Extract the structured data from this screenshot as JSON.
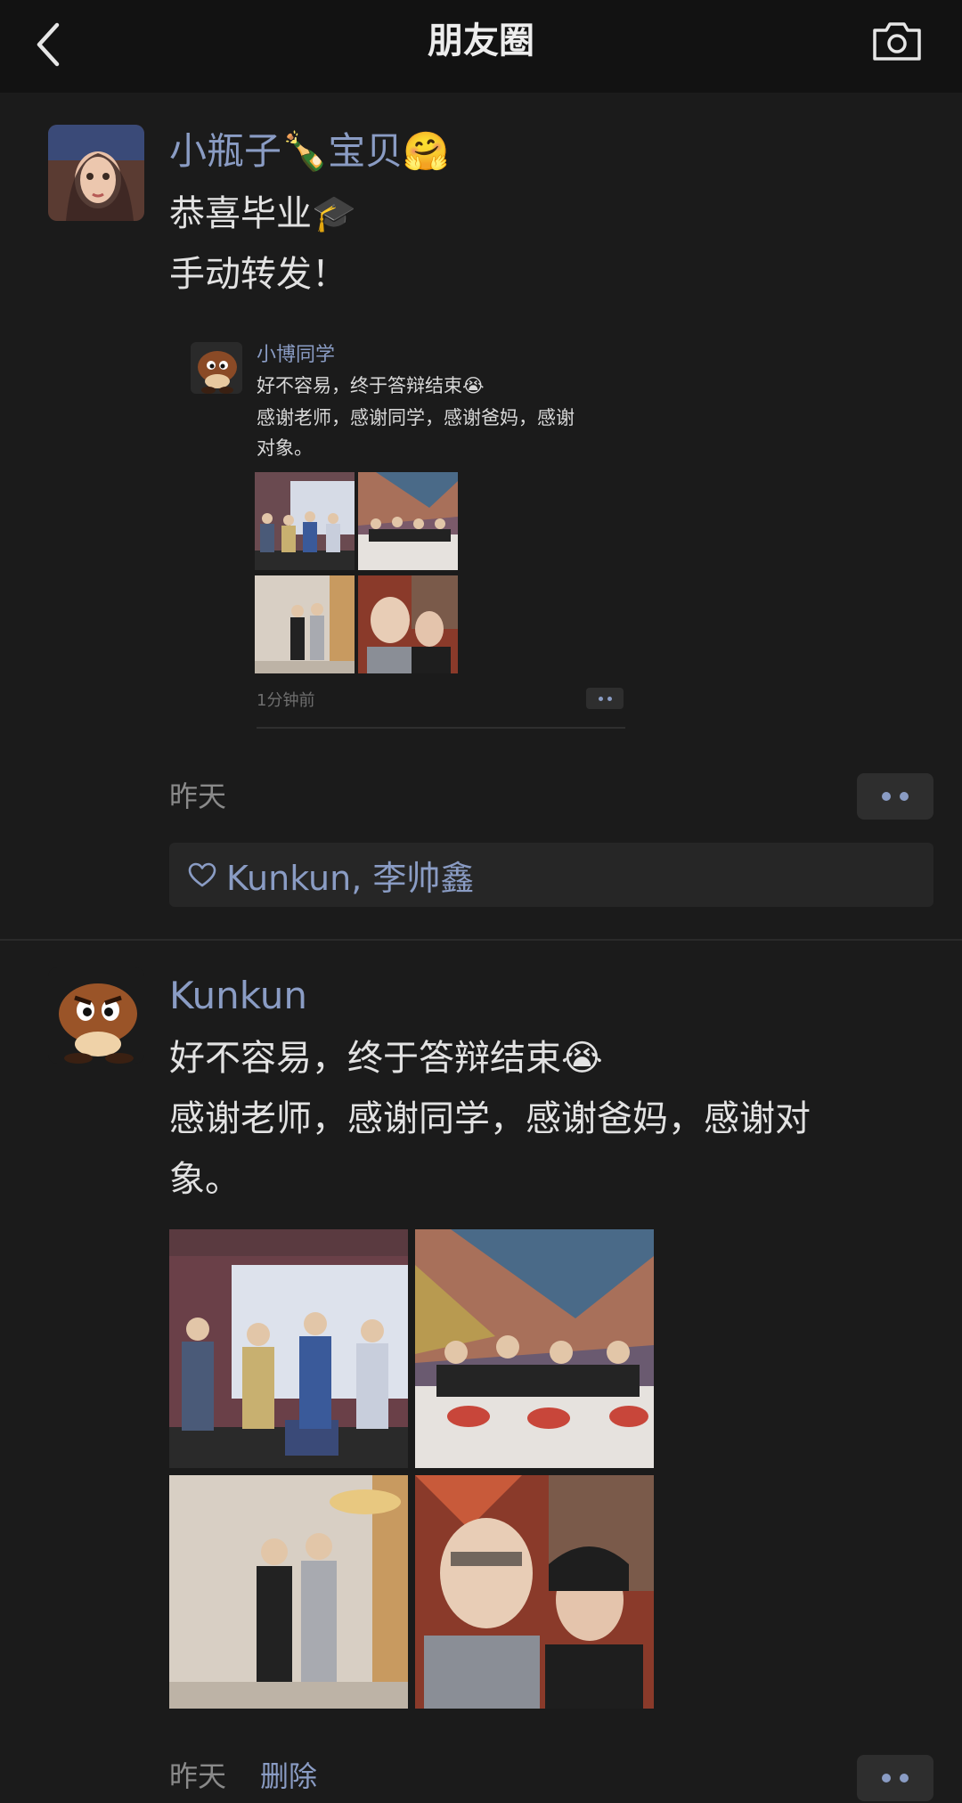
{
  "header": {
    "title": "朋友圈",
    "back_icon": "chevron-left-icon",
    "camera_icon": "camera-icon"
  },
  "post1": {
    "author": "小瓶子🍾宝贝🤗",
    "lines": [
      "恭喜毕业🎓",
      "手动转发！"
    ],
    "forwarded": {
      "author": "小博同学",
      "lines": [
        "好不容易，终于答辩结束😭",
        "感谢老师，感谢同学，感谢爸妈，感谢",
        "对象。"
      ],
      "time": "1分钟前"
    },
    "time": "昨天",
    "likes": "Kunkun, 李帅鑫",
    "like_icon": "heart-outline-icon"
  },
  "post2": {
    "author": "Kunkun",
    "lines": [
      "好不容易，终于答辩结束😭",
      "感谢老师，感谢同学，感谢爸妈，感谢对",
      "象。"
    ],
    "time": "昨天",
    "delete_label": "删除"
  },
  "colors": {
    "background": "#1b1b1b",
    "nickname": "#8a9cc4",
    "text": "#e2e2e2"
  }
}
